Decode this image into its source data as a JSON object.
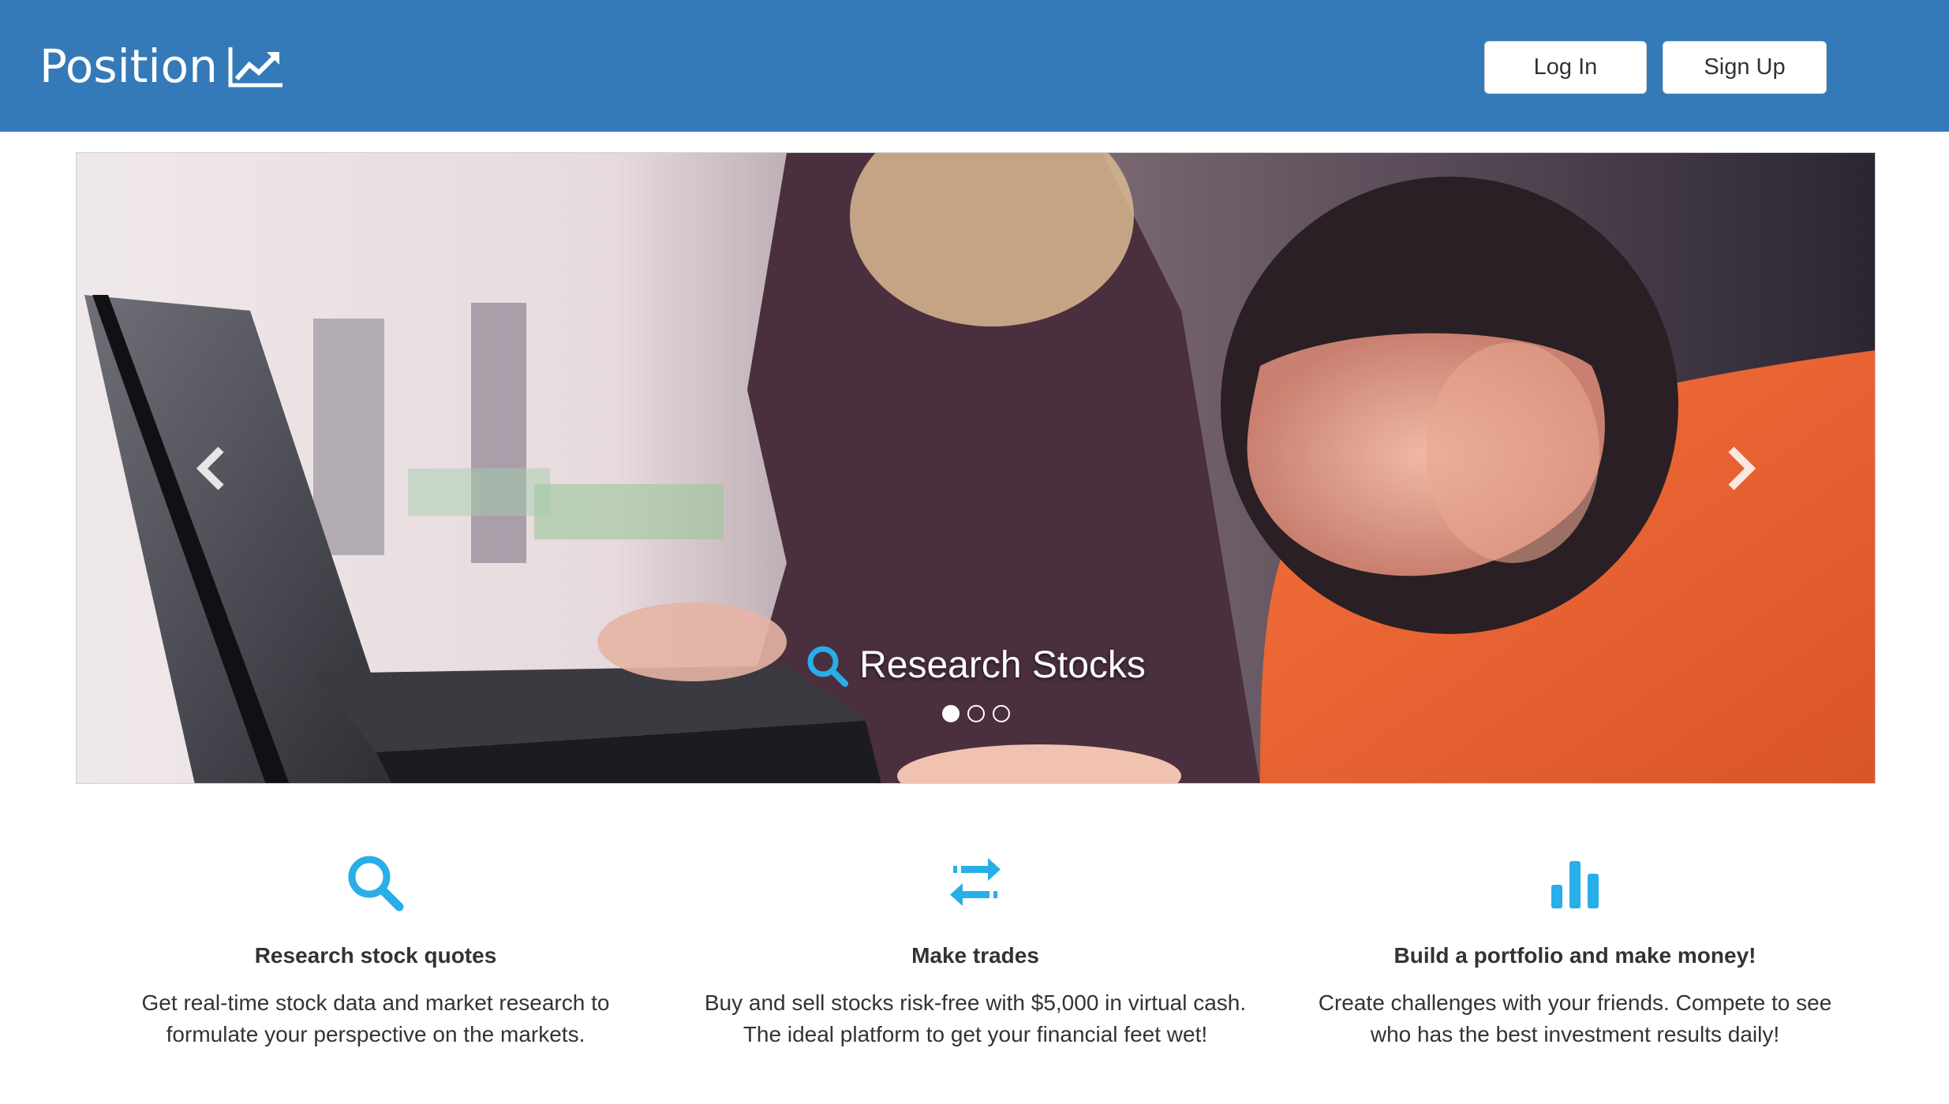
{
  "colors": {
    "navbar_bg": "#347ab9",
    "accent_icon": "#28aee8",
    "text": "#333333"
  },
  "header": {
    "brand": "Position",
    "brand_icon": "line-chart-icon",
    "login_label": "Log In",
    "signup_label": "Sign Up"
  },
  "carousel": {
    "caption": "Research Stocks",
    "caption_icon": "search-icon",
    "slide_count": 3,
    "active_slide": 1,
    "prev_icon": "chevron-left-icon",
    "next_icon": "chevron-right-icon"
  },
  "features": [
    {
      "icon": "search-icon",
      "title": "Research stock quotes",
      "line1": "Get real-time stock data and market research to",
      "line2": "formulate your perspective on the markets."
    },
    {
      "icon": "transfer-arrows-icon",
      "title": "Make trades",
      "line1": "Buy and sell stocks risk-free with $5,000 in virtual cash.",
      "line2": "The ideal platform to get your financial feet wet!"
    },
    {
      "icon": "bar-chart-icon",
      "title": "Build a portfolio and make money!",
      "line1": "Create challenges with your friends. Compete to see",
      "line2": "who has the best investment results daily!"
    }
  ]
}
